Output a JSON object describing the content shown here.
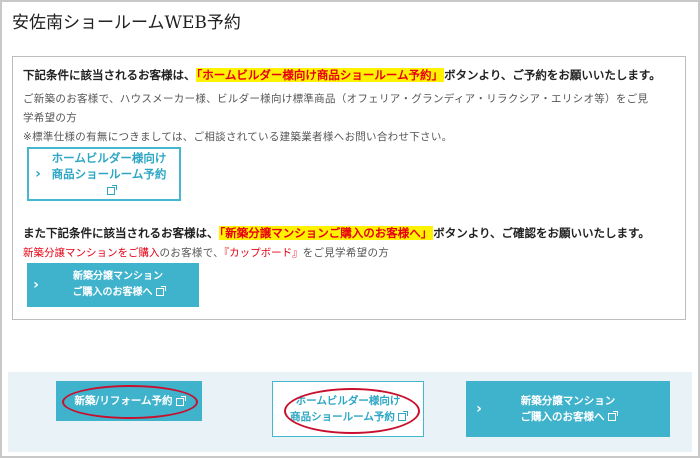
{
  "page_title": "安佐南ショールームWEB予約",
  "notice": {
    "line1_prefix": "下記条件に該当されるお客様は、",
    "line1_highlight": "「ホームビルダー様向け商品ショールーム予約」",
    "line1_suffix": "ボタンより、ご予約をお願いいたします。",
    "line2": "ご新築のお客様で、ハウスメーカー様、ビルダー様向け標準商品（オフェリア・グランディア・リラクシア・エリシオ等）をご見",
    "line3": "学希望の方",
    "line4": "※標準仕様の有無につきましては、ご相談されている建築業者様へお問い合わせ下さい。",
    "builder_button": {
      "line1": "ホームビルダー様向け",
      "line2": "商品ショールーム予約"
    },
    "line5_prefix": "また下記条件に該当されるお客様は、",
    "line5_highlight": "「新築分譲マンションご購入のお客様へ」",
    "line5_suffix": "ボタンより、ご確認をお願いいたします。",
    "line6_red_a": "新築分譲マンションをご購入",
    "line6_normal_a": "のお客様で、",
    "line6_red_b": "『カップボード』",
    "line6_normal_b": "をご見学希望の方",
    "condo_button": {
      "line1": "新築分譲マンション",
      "line2": "ご購入のお客様へ"
    }
  },
  "footer_buttons": {
    "renovation": "新築/リフォーム予約",
    "builder": {
      "line1": "ホームビルダー様向け",
      "line2": "商品ショールーム予約"
    },
    "condo": {
      "line1": "新築分譲マンション",
      "line2": "ご購入のお客様へ"
    }
  },
  "icons": {
    "chevron": "chevron-right-icon",
    "external": "external-link-icon"
  },
  "colors": {
    "accent": "#3fb2cc",
    "highlight_bg": "#fff200",
    "highlight_text": "#e60012",
    "annotation": "#c8102e",
    "footer_bg": "#e8f2f7"
  }
}
